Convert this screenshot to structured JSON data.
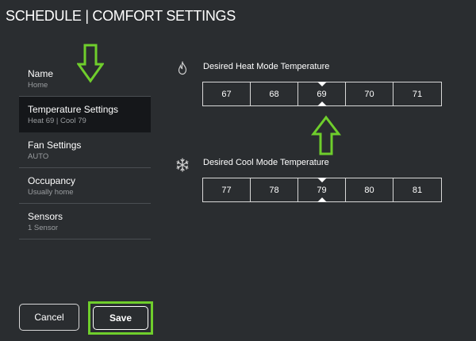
{
  "header": {
    "title": "SCHEDULE | COMFORT SETTINGS"
  },
  "sidebar": {
    "items": [
      {
        "label": "Name",
        "sub": "Home"
      },
      {
        "label": "Temperature Settings",
        "sub": "Heat 69 | Cool 79"
      },
      {
        "label": "Fan Settings",
        "sub": "AUTO"
      },
      {
        "label": "Occupancy",
        "sub": "Usually home"
      },
      {
        "label": "Sensors",
        "sub": "1 Sensor"
      }
    ],
    "active_index": 1
  },
  "heat": {
    "label": "Desired Heat Mode Temperature",
    "icon": "flame-icon",
    "options": [
      "67",
      "68",
      "69",
      "70",
      "71"
    ],
    "selected": "69"
  },
  "cool": {
    "label": "Desired Cool Mode Temperature",
    "icon": "snowflake-icon",
    "options": [
      "77",
      "78",
      "79",
      "80",
      "81"
    ],
    "selected": "79"
  },
  "footer": {
    "cancel_label": "Cancel",
    "save_label": "Save"
  },
  "colors": {
    "background": "#2a2d30",
    "active_item": "#15171a",
    "highlight": "#6fce2c",
    "text": "#ffffff",
    "subtext": "#9a9da0"
  }
}
